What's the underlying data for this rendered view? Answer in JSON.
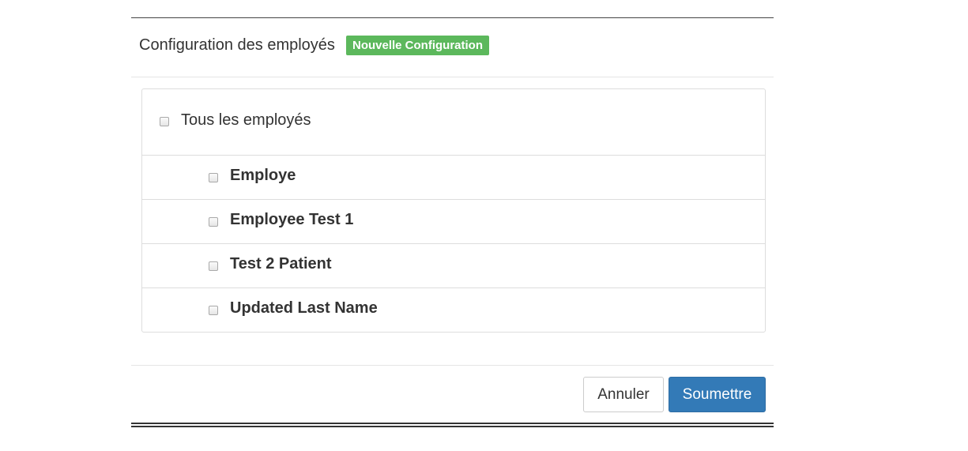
{
  "header": {
    "title": "Configuration des employés",
    "badge": "Nouvelle Configuration",
    "badge_color": "#5cb85c"
  },
  "select_all": {
    "label": "Tous les employés",
    "checked": false
  },
  "employees": [
    {
      "label": "Employe",
      "checked": false
    },
    {
      "label": "Employee Test 1",
      "checked": false
    },
    {
      "label": "Test 2 Patient",
      "checked": false
    },
    {
      "label": "Updated Last Name",
      "checked": false
    }
  ],
  "footer": {
    "cancel_label": "Annuler",
    "submit_label": "Soumettre",
    "submit_color": "#337ab7"
  }
}
